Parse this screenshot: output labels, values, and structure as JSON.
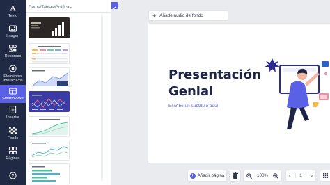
{
  "rail": [
    {
      "key": "texto",
      "label": "Texto",
      "icon": "text-icon"
    },
    {
      "key": "imagen",
      "label": "Imagen",
      "icon": "image-icon"
    },
    {
      "key": "recursos",
      "label": "Recursos",
      "icon": "resources-icon"
    },
    {
      "key": "elementos",
      "label": "Elementos interactivos",
      "icon": "interactive-icon"
    },
    {
      "key": "smartblocks",
      "label": "Smartblocks",
      "icon": "smartblocks-icon",
      "active": true
    },
    {
      "key": "insertar",
      "label": "Insertar",
      "icon": "insert-icon"
    },
    {
      "key": "fondo",
      "label": "Fondo",
      "icon": "background-icon"
    },
    {
      "key": "paginas",
      "label": "Páginas",
      "icon": "pages-icon"
    },
    {
      "key": "ayuda",
      "label": "",
      "icon": "help-icon"
    }
  ],
  "panel": {
    "title": "Datos/Tablas/Gráficas"
  },
  "toolbar": {
    "audio_label": "Añade audio de fondo"
  },
  "slide": {
    "title_line1": "Presentación",
    "title_line2": "Genial",
    "subtitle": "Escribe un subtítulo aquí"
  },
  "bottom": {
    "add_page_label": "Añadir página",
    "zoom": "100%",
    "page": "1"
  },
  "colors": {
    "rail_bg": "#202a44",
    "accent": "#5b61e6",
    "title": "#1f2547"
  }
}
